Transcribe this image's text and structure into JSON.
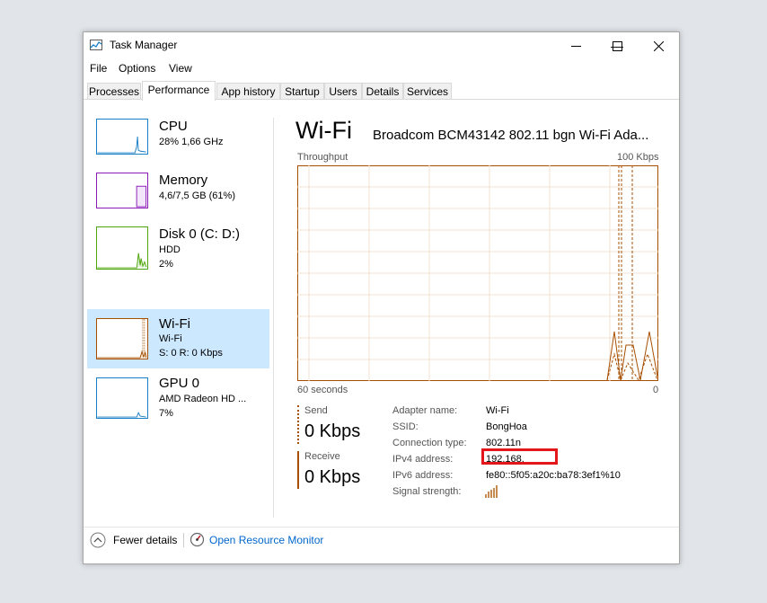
{
  "window": {
    "title": "Task Manager",
    "controls": {
      "minimize": "—",
      "maximize": "☐",
      "close": "✕"
    }
  },
  "menu": [
    "File",
    "Options",
    "View"
  ],
  "tabs": [
    "Processes",
    "Performance",
    "App history",
    "Startup",
    "Users",
    "Details",
    "Services"
  ],
  "sidebar": {
    "items": [
      {
        "title": "CPU",
        "line1": "28% 1,66 GHz",
        "line2": ""
      },
      {
        "title": "Memory",
        "line1": "4,6/7,5 GB (61%)",
        "line2": ""
      },
      {
        "title": "Disk 0 (C: D:)",
        "line1": "HDD",
        "line2": "2%"
      },
      {
        "title": "Wi-Fi",
        "line1": "Wi-Fi",
        "line2": "S: 0 R: 0 Kbps"
      },
      {
        "title": "GPU 0",
        "line1": "AMD Radeon HD ...",
        "line2": "7%"
      }
    ],
    "colors": {
      "cpu": "#1a7fc4",
      "memory": "#8b1ab8",
      "disk": "#4da60c",
      "wifi": "#a74f01",
      "gpu": "#1a7fc4"
    }
  },
  "main": {
    "title": "Wi-Fi",
    "adapter_desc": "Broadcom BCM43142 802.11 bgn Wi-Fi Ada...",
    "throughput_label": "Throughput",
    "max_label": "100 Kbps",
    "time_label": "60 seconds",
    "zero_label": "0",
    "send_label": "Send",
    "send_value": "0 Kbps",
    "receive_label": "Receive",
    "receive_value": "0 Kbps",
    "info": [
      {
        "label": "Adapter name:",
        "value": "Wi-Fi"
      },
      {
        "label": "SSID:",
        "value": "BongHoa"
      },
      {
        "label": "Connection type:",
        "value": "802.11n"
      },
      {
        "label": "IPv4 address:",
        "value": "192.168."
      },
      {
        "label": "IPv6 address:",
        "value": "fe80::5f05:a20c:ba78:3ef1%10"
      },
      {
        "label": "Signal strength:",
        "value": ""
      }
    ],
    "graph_color": "#a74f01"
  },
  "footer": {
    "fewer_details": "Fewer details",
    "open_monitor": "Open Resource Monitor"
  }
}
